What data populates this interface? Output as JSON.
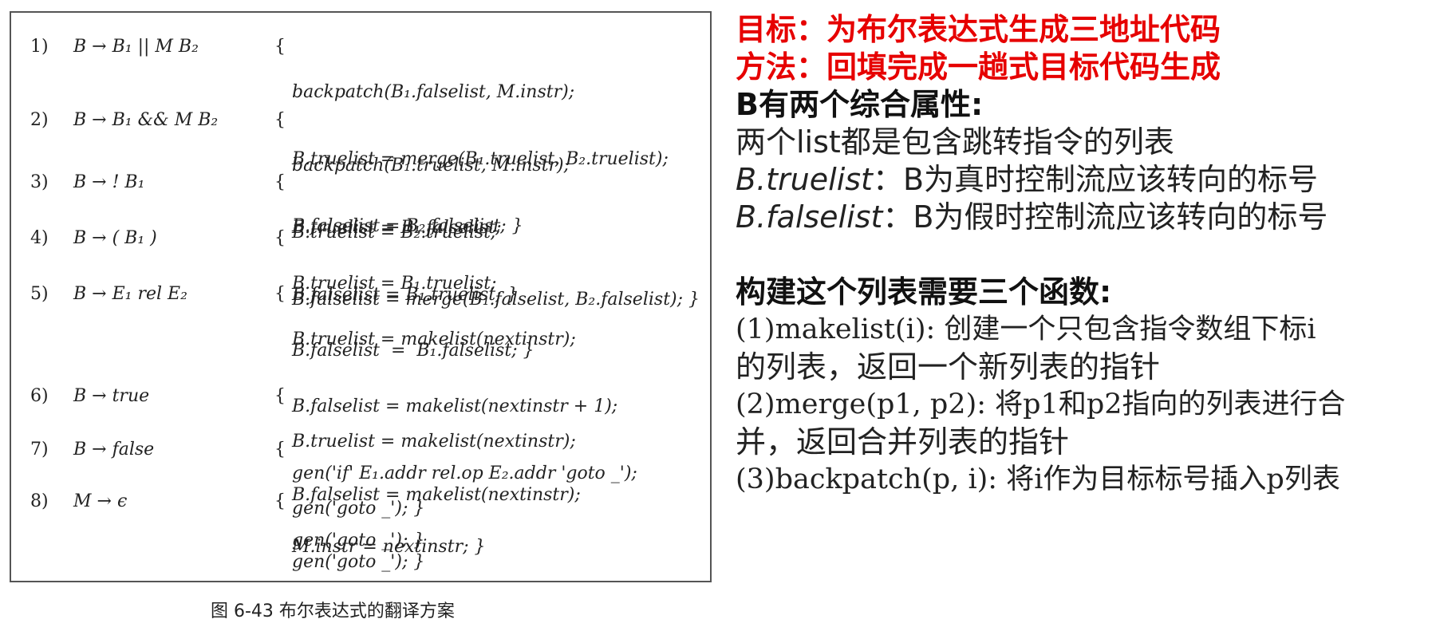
{
  "figure": {
    "rules": [
      {
        "num": "1)",
        "production": "B → B₁ || M B₂",
        "actions": [
          "backpatch(B₁.falselist, M.instr);",
          "B.truelist = merge(B₁.truelist, B₂.truelist);",
          "B.falselist = B₂.falselist; }"
        ]
      },
      {
        "num": "2)",
        "production": "B → B₁ && M B₂",
        "actions": [
          "backpatch(B₁.truelist, M.instr);",
          "B.truelist = B₂.truelist;",
          "B.falselist = merge(B₁.falselist, B₂.falselist); }"
        ]
      },
      {
        "num": "3)",
        "production": "B → ! B₁",
        "actions": [
          "B.truelist = B₁.falselist;",
          "B.falselist = B₁.truelist; }"
        ]
      },
      {
        "num": "4)",
        "production": "B → ( B₁ )",
        "actions": [
          "B.truelist = B₁.truelist;",
          "B.falselist  =  B₁.falselist; }"
        ]
      },
      {
        "num": "5)",
        "production": "B → E₁ rel E₂",
        "actions": [
          "B.truelist = makelist(nextinstr);",
          "B.falselist = makelist(nextinstr + 1);",
          "gen('if' E₁.addr rel.op E₂.addr 'goto _');",
          "gen('goto _'); }"
        ]
      },
      {
        "num": "6)",
        "production": "B → true",
        "actions": [
          "B.truelist = makelist(nextinstr);",
          "gen('goto _'); }"
        ]
      },
      {
        "num": "7)",
        "production": "B → false",
        "actions": [
          "B.falselist = makelist(nextinstr);",
          "gen('goto _'); }"
        ]
      },
      {
        "num": "8)",
        "production": "M → ϵ",
        "actions": [
          "M.instr = nextinstr; }"
        ]
      }
    ],
    "brace": "{",
    "caption": "图 6-43   布尔表达式的翻译方案"
  },
  "notes": {
    "goal": "目标：为布尔表达式生成三地址代码",
    "method": "方法：回填完成一趟式目标代码生成",
    "attrs_heading": "B有两个综合属性:",
    "lists_desc": "两个list都是包含跳转指令的列表",
    "truelist_name": "B.truelist",
    "truelist_desc": "：B为真时控制流应该转向的标号",
    "falselist_name": "B.falselist",
    "falselist_desc": "：B为假时控制流应该转向的标号",
    "funcs_heading": "构建这个列表需要三个函数:",
    "f1_line1": "(1)makelist(i): 创建一个只包含指令数组下标i",
    "f1_line2": "的列表，返回一个新列表的指针",
    "f2_line1": "(2)merge(p1, p2): 将p1和p2指向的列表进行合",
    "f2_line2": "并，返回合并列表的指针",
    "f3_line1": "(3)backpatch(p, i): 将i作为目标标号插入p列表"
  }
}
